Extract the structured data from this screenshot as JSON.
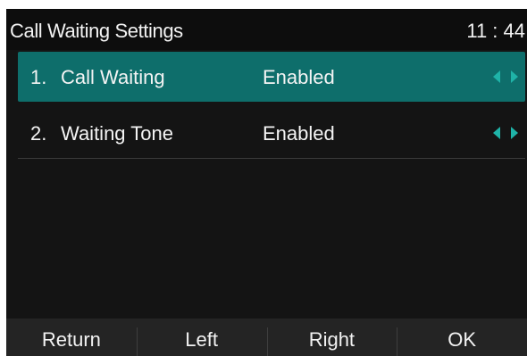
{
  "header": {
    "title": "Call Waiting Settings",
    "clock": "11 : 44"
  },
  "settings": {
    "items": [
      {
        "index": "1.",
        "label": "Call Waiting",
        "value": "Enabled",
        "selected": true
      },
      {
        "index": "2.",
        "label": "Waiting Tone",
        "value": "Enabled",
        "selected": false
      }
    ],
    "arrow_icon": "left-right-arrows-icon"
  },
  "softkeys": {
    "return_label": "Return",
    "left_label": "Left",
    "right_label": "Right",
    "ok_label": "OK"
  },
  "colors": {
    "background": "#141414",
    "selected_row": "#0e6e6b",
    "accent_arrows": "#1fb3a8",
    "softkey_bar": "#242424"
  }
}
